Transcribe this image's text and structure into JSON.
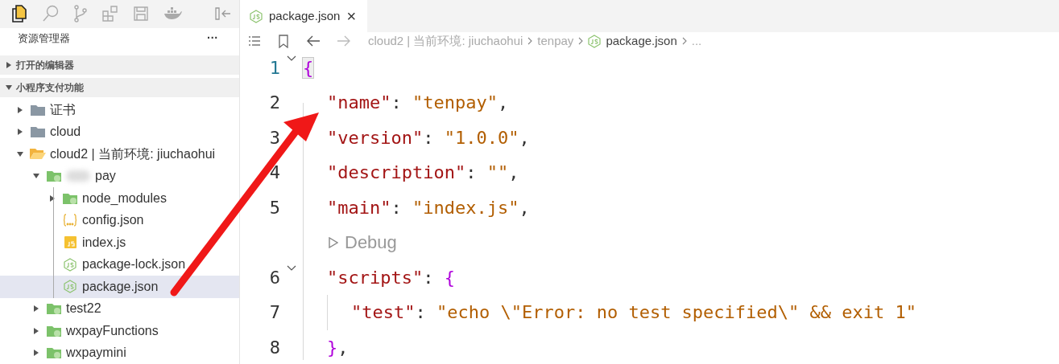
{
  "activity_bar": {
    "icons": [
      {
        "kind": "files",
        "selected": true
      },
      {
        "kind": "search",
        "selected": false
      },
      {
        "kind": "branch",
        "selected": false
      },
      {
        "kind": "extensions",
        "selected": false
      },
      {
        "kind": "save",
        "selected": false
      },
      {
        "kind": "docker",
        "selected": false
      }
    ]
  },
  "sidebar": {
    "title": "资源管理器",
    "more": "···",
    "sections": [
      {
        "label": "打开的编辑器",
        "expanded": false
      },
      {
        "label": "小程序支付功能",
        "expanded": true
      }
    ],
    "tree": [
      {
        "label": "证书",
        "kind": "folder",
        "expanded": false,
        "selected": false
      },
      {
        "label": "cloud",
        "kind": "folder",
        "expanded": false,
        "selected": false
      },
      {
        "label": "cloud2 | 当前环境: jiuchaohui",
        "kind": "cloud-folder",
        "expanded": true,
        "selected": false,
        "children": [
          {
            "label": "pay",
            "kind": "function-folder",
            "redacted": true,
            "expanded": true,
            "selected": false,
            "children": [
              {
                "label": "node_modules",
                "kind": "function-folder",
                "expanded": false,
                "selected": false
              },
              {
                "label": "config.json",
                "kind": "json",
                "selected": false
              },
              {
                "label": "index.js",
                "kind": "js",
                "selected": false
              },
              {
                "label": "package-lock.json",
                "kind": "node",
                "selected": false
              },
              {
                "label": "package.json",
                "kind": "node",
                "selected": true
              }
            ]
          },
          {
            "label": "test22",
            "kind": "function-folder",
            "expanded": false,
            "selected": false
          },
          {
            "label": "wxpayFunctions",
            "kind": "function-folder",
            "expanded": false,
            "selected": false
          },
          {
            "label": "wxpaymini",
            "kind": "function-folder",
            "expanded": false,
            "selected": false
          }
        ]
      }
    ]
  },
  "editor": {
    "tabs": [
      {
        "label": "package.json",
        "close": "×",
        "selected": true
      }
    ],
    "breadcrumb": [
      "cloud2 | 当前环境: jiuchaohui",
      "tenpay",
      "package.json",
      "..."
    ],
    "lines": [
      {
        "kind": "code",
        "number": "1",
        "active": true,
        "fold": true,
        "tokens": [
          {
            "kind": "brace",
            "text": "{",
            "matched": true
          }
        ]
      },
      {
        "kind": "code",
        "number": "2",
        "active": false,
        "fold": false,
        "tokens": [
          {
            "kind": "key",
            "text": "\"name\""
          },
          {
            "kind": "punct",
            "text": ": "
          },
          {
            "kind": "string",
            "text": "\"tenpay\""
          },
          {
            "kind": "punct",
            "text": ","
          }
        ]
      },
      {
        "kind": "code",
        "number": "3",
        "active": false,
        "fold": false,
        "tokens": [
          {
            "kind": "key",
            "text": "\"version\""
          },
          {
            "kind": "punct",
            "text": ": "
          },
          {
            "kind": "string",
            "text": "\"1.0.0\""
          },
          {
            "kind": "punct",
            "text": ","
          }
        ]
      },
      {
        "kind": "code",
        "number": "4",
        "active": false,
        "fold": false,
        "tokens": [
          {
            "kind": "key",
            "text": "\"description\""
          },
          {
            "kind": "punct",
            "text": ": "
          },
          {
            "kind": "string",
            "text": "\"\""
          },
          {
            "kind": "punct",
            "text": ","
          }
        ]
      },
      {
        "kind": "code",
        "number": "5",
        "active": false,
        "fold": false,
        "tokens": [
          {
            "kind": "key",
            "text": "\"main\""
          },
          {
            "kind": "punct",
            "text": ": "
          },
          {
            "kind": "string",
            "text": "\"index.js\""
          },
          {
            "kind": "punct",
            "text": ","
          }
        ]
      },
      {
        "kind": "codelens",
        "text": "Debug"
      },
      {
        "kind": "code",
        "number": "6",
        "active": false,
        "fold": true,
        "tokens": [
          {
            "kind": "key",
            "text": "\"scripts\""
          },
          {
            "kind": "punct",
            "text": ": "
          },
          {
            "kind": "brace",
            "text": "{"
          }
        ]
      },
      {
        "kind": "code",
        "number": "7",
        "active": false,
        "fold": false,
        "tokens": [
          {
            "kind": "key",
            "text": "\"test\""
          },
          {
            "kind": "punct",
            "text": ": "
          },
          {
            "kind": "string",
            "text": "\"echo \\\"Error: no test specified\\\" && exit 1\""
          }
        ]
      },
      {
        "kind": "code",
        "number": "8",
        "active": false,
        "fold": false,
        "tokens": [
          {
            "kind": "brace",
            "text": "}"
          },
          {
            "kind": "punct",
            "text": ","
          }
        ]
      }
    ]
  }
}
